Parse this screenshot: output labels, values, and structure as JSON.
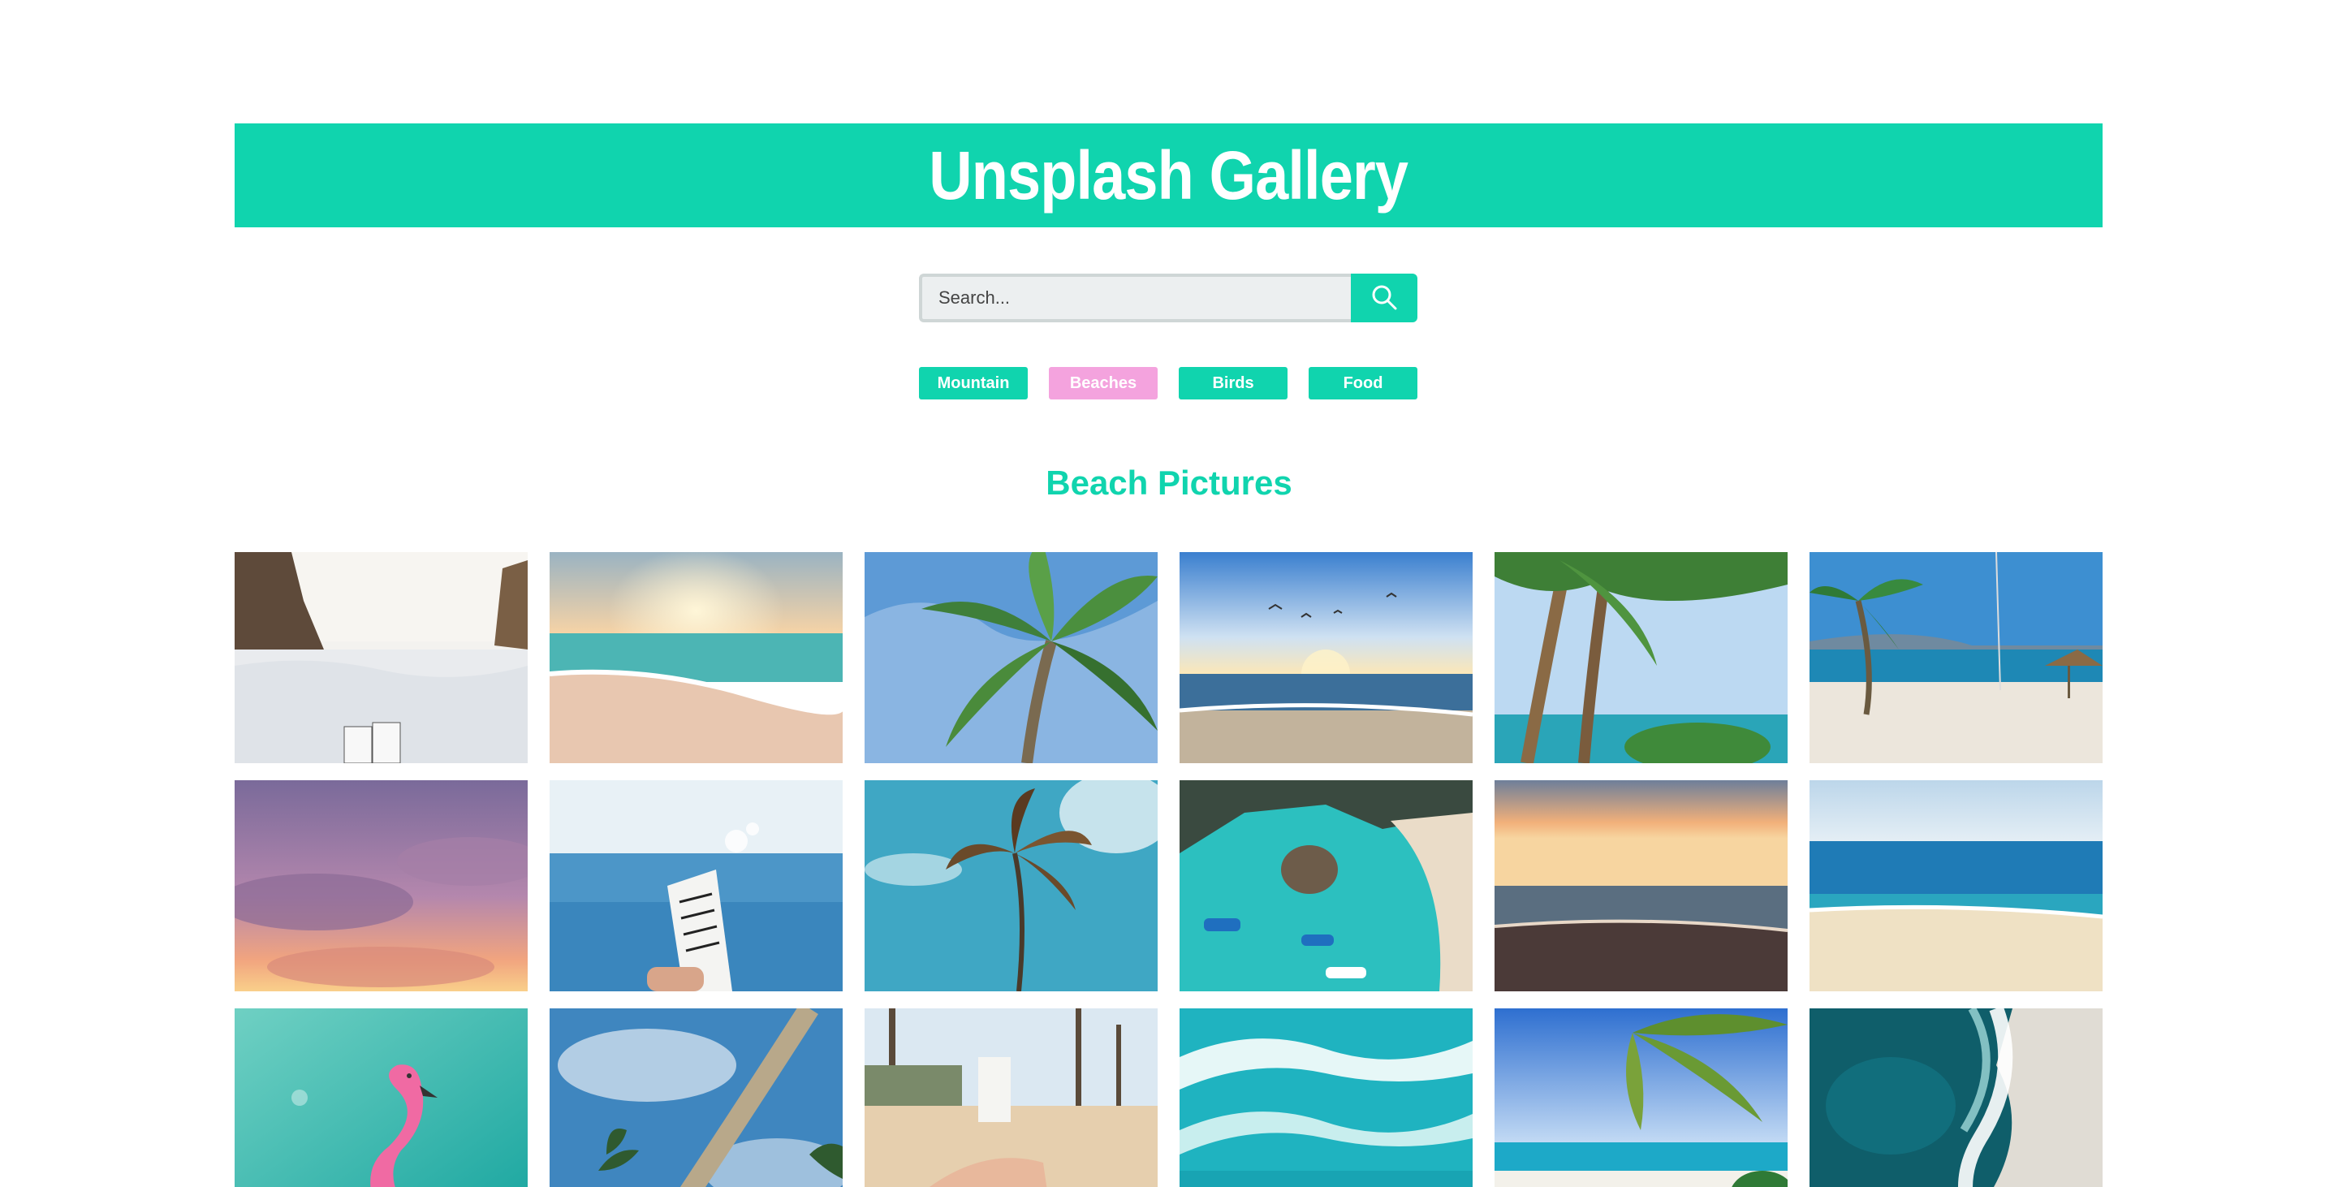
{
  "header": {
    "title": "Unsplash Gallery"
  },
  "search": {
    "placeholder": "Search...",
    "value": "",
    "button_icon": "search-icon"
  },
  "filters": [
    {
      "label": "Mountain",
      "active": false
    },
    {
      "label": "Beaches",
      "active": true
    },
    {
      "label": "Birds",
      "active": false
    },
    {
      "label": "Food",
      "active": false
    }
  ],
  "section": {
    "title": "Beach Pictures"
  },
  "colors": {
    "accent": "#10d4ae",
    "active_filter": "#f4a3de",
    "search_bg": "#eceff0"
  },
  "gallery": {
    "images": [
      {
        "subject": "rocky shore with sea foam and boxed water carton"
      },
      {
        "subject": "sunrise over beach waves"
      },
      {
        "subject": "palm tree against blue sky"
      },
      {
        "subject": "sunset beach with seagulls"
      },
      {
        "subject": "palm trees on tropical shore"
      },
      {
        "subject": "palm tree and beach hut"
      },
      {
        "subject": "purple sunset clouds"
      },
      {
        "subject": "boxed water carton held over sea"
      },
      {
        "subject": "palm tree against turquoise sky"
      },
      {
        "subject": "aerial view of boats in turquoise water"
      },
      {
        "subject": "sunset over ocean shore"
      },
      {
        "subject": "empty sandy beach with blue sea"
      },
      {
        "subject": "pink flamingo float on turquoise water"
      },
      {
        "subject": "palm tree trunk against cloudy sky"
      },
      {
        "subject": "boxed water on beach with palm trees"
      },
      {
        "subject": "aerial ocean waves"
      },
      {
        "subject": "palm leaves over tropical beach"
      },
      {
        "subject": "aerial waves meeting sand"
      }
    ]
  }
}
